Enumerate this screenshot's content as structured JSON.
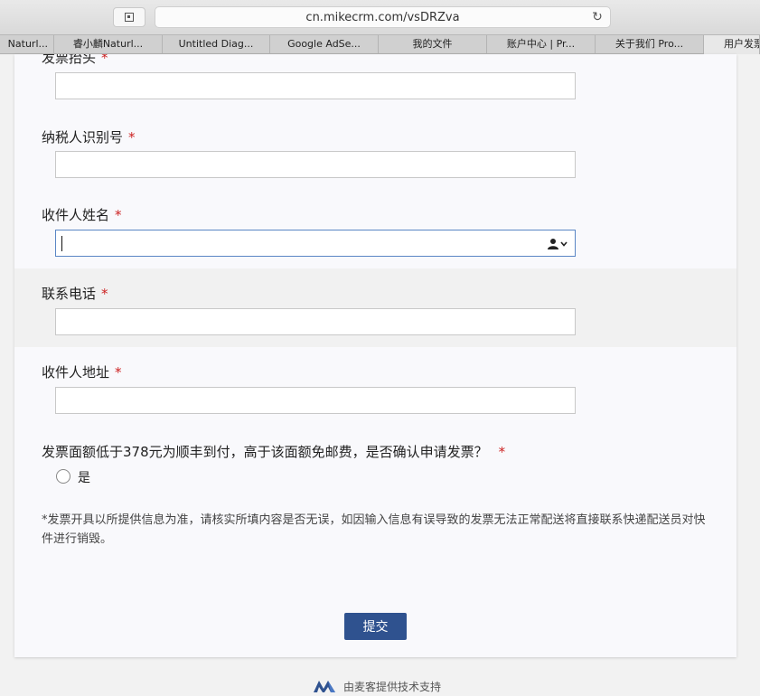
{
  "browser": {
    "url": "cn.mikecrm.com/vsDRZva",
    "tabs": [
      {
        "label": "Naturl..."
      },
      {
        "label": "睿小麟Naturl..."
      },
      {
        "label": "Untitled Diag..."
      },
      {
        "label": "Google AdSe..."
      },
      {
        "label": "我的文件"
      },
      {
        "label": "账户中心 | Pr..."
      },
      {
        "label": "关于我们 Pro..."
      },
      {
        "label": "用户发票"
      }
    ]
  },
  "form": {
    "required_mark": "*",
    "fields": [
      {
        "label": "发票抬头",
        "value": ""
      },
      {
        "label": "纳税人识别号",
        "value": ""
      },
      {
        "label": "收件人姓名",
        "value": ""
      },
      {
        "label": "联系电话",
        "value": ""
      },
      {
        "label": "收件人地址",
        "value": ""
      }
    ],
    "question": {
      "label": "发票面额低于378元为顺丰到付，高于该面额免邮费，是否确认申请发票？",
      "option": "是"
    },
    "notice": "*发票开具以所提供信息为准，请核实所填内容是否无误，如因输入信息有误导致的发票无法正常配送将直接联系快递配送员对快件进行销毁。",
    "submit_label": "提交"
  },
  "footer": {
    "text": "由麦客提供技术支持"
  },
  "colors": {
    "accent": "#2f528f",
    "required": "#cc2222",
    "focus_border": "#5a86c5"
  }
}
